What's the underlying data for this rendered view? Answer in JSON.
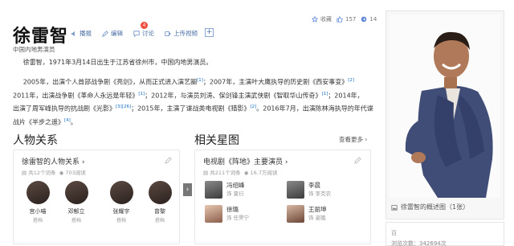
{
  "header": {
    "title": "徐雷智",
    "actions": [
      {
        "label": "播报",
        "icon": "speaker-icon"
      },
      {
        "label": "编辑",
        "icon": "pencil-icon"
      },
      {
        "label": "讨论",
        "icon": "comment-icon",
        "badge": "4"
      },
      {
        "label": "上传视频",
        "icon": "video-icon"
      }
    ],
    "plus": "+",
    "collect": "收藏",
    "likes": "157",
    "shares": "14"
  },
  "subtitle": "中国内地男演员",
  "intro": "徐雷智，1971年3月14日出生于江苏省徐州市，中国内地男演员。",
  "paragraph": {
    "l1a": "2005年，出演个人首部战争剧《亮剑》，从而正式进入演艺圈",
    "r1": "[1]",
    "l1b": "；2007年，主演叶大鹰执导的历史剧《西安事变》",
    "r2": "[2]",
    "l2a": "2011年，出演战争剧《革命人永远是年轻》",
    "r3": "[1]",
    "l2b": "；2012年，与演员刘涛、保剑锋主演武侠剧《智取华山传奇》",
    "r4": "[1]",
    "l2c": "；2014年，",
    "l3a": "出演了周军峰执导的抗战剧《光影》",
    "r5": "[3]",
    "r6": "[26]",
    "l3b": "；2015年，主演了谍战类电视剧《猎影》",
    "r7": "[2]",
    "l3c": "。2016年7月，出演陈林海执导的年代谍",
    "l4a": "战片《半步之遥》",
    "r8": "[4]",
    "l4b": "。"
  },
  "relations": {
    "section_title": "人物关系",
    "card_title": "徐雷智的人物关系",
    "meta_a": "共12个词条",
    "meta_b": "703阅读",
    "people": [
      {
        "name": "宫小喵",
        "role": "搭档"
      },
      {
        "name": "邓郁立",
        "role": "搭档"
      },
      {
        "name": "张耀宇",
        "role": "搭档"
      },
      {
        "name": "曾黎",
        "role": "搭档"
      }
    ]
  },
  "stars": {
    "section_title": "相关星图",
    "more": "查看更多",
    "card_title": "电视剧《阵地》主要演员",
    "meta_a": "共211个词条",
    "meta_b": "16.7万阅读",
    "actors": [
      {
        "name": "冯绍峰",
        "role": "饰 夏衍"
      },
      {
        "name": "李晨",
        "role": "饰 李克农"
      },
      {
        "name": "徐璐",
        "role": "饰 任霁宁"
      },
      {
        "name": "王丽坤",
        "role": "饰 姿娥"
      }
    ]
  },
  "sidebar": {
    "caption": "徐雷智的概述图（1张）",
    "lower_label": "百",
    "lower_text": "浏览次数：342694次"
  }
}
